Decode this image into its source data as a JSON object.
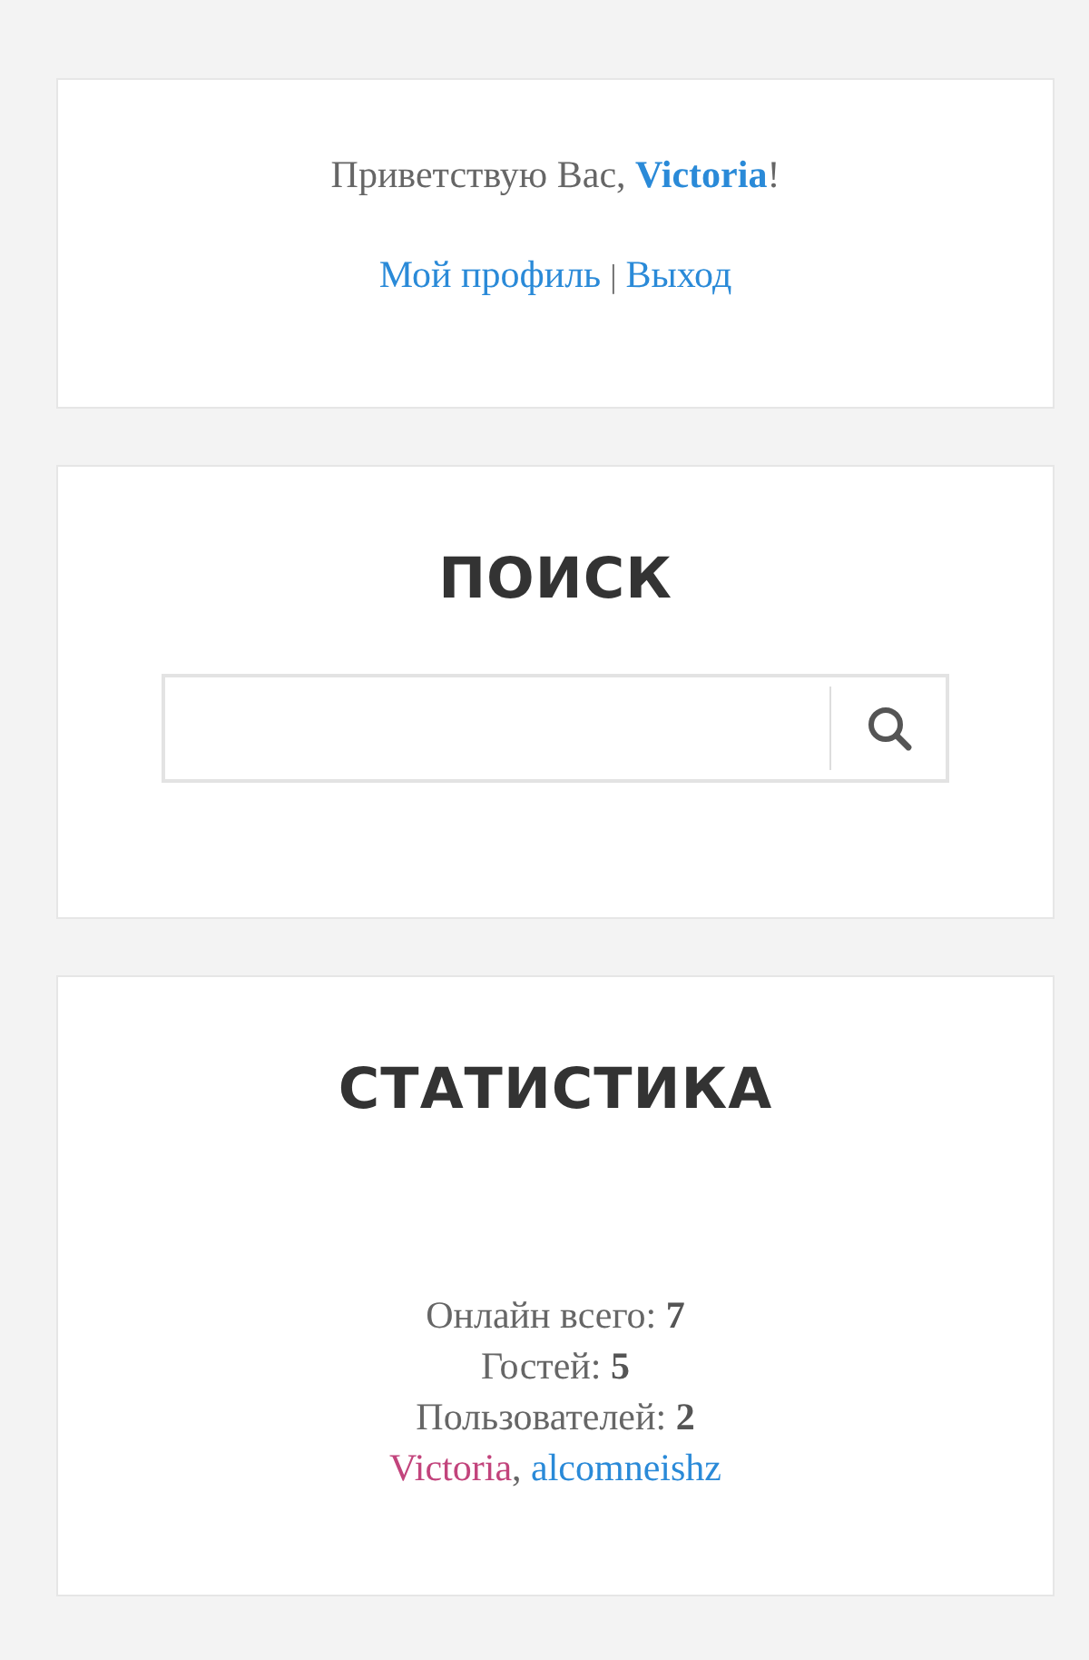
{
  "login_panel": {
    "greeting_prefix": "Приветствую Вас, ",
    "user_link": "Victoria",
    "greeting_suffix": "!",
    "links": [
      {
        "label": "Мой профиль"
      },
      {
        "label": "Выход"
      }
    ],
    "separator": "|"
  },
  "search_panel": {
    "title": "ПОИСК"
  },
  "stats_panel": {
    "title": "СТАТИСТИКА",
    "lines": [
      "Онлайн всего: **7**",
      "Гостей: **5**",
      "Пользователей: **2**"
    ],
    "users": [
      {
        "name": "Victoria",
        "color": "#c2447c"
      },
      {
        "name": "alcomneishz",
        "color": "#2a8ad8"
      }
    ],
    "user_separator": ","
  }
}
